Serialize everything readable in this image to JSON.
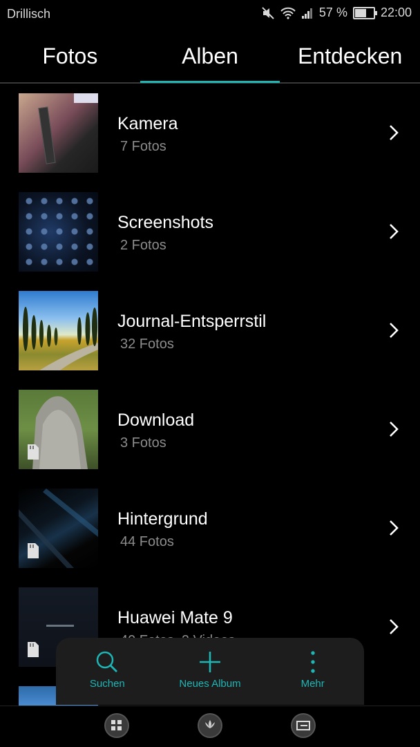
{
  "status": {
    "carrier": "Drillisch",
    "battery": "57 %",
    "time": "22:00",
    "battery_level": 0.57
  },
  "tabs": [
    {
      "label": "Fotos"
    },
    {
      "label": "Alben"
    },
    {
      "label": "Entdecken"
    }
  ],
  "active_tab": "Alben",
  "albums": [
    {
      "title": "Kamera",
      "count": "7 Fotos"
    },
    {
      "title": "Screenshots",
      "count": "2 Fotos"
    },
    {
      "title": "Journal-Entsperrstil",
      "count": "32 Fotos"
    },
    {
      "title": "Download",
      "count": "3 Fotos"
    },
    {
      "title": "Hintergrund",
      "count": "44 Fotos"
    },
    {
      "title": "Huawei Mate 9",
      "count": "40 Fotos, 2 Videos"
    }
  ],
  "actions": [
    {
      "label": "Suchen",
      "icon": "search-icon"
    },
    {
      "label": "Neues Album",
      "icon": "plus-icon"
    },
    {
      "label": "Mehr",
      "icon": "more-vertical-icon"
    }
  ],
  "accent_color": "#1fb5b5"
}
